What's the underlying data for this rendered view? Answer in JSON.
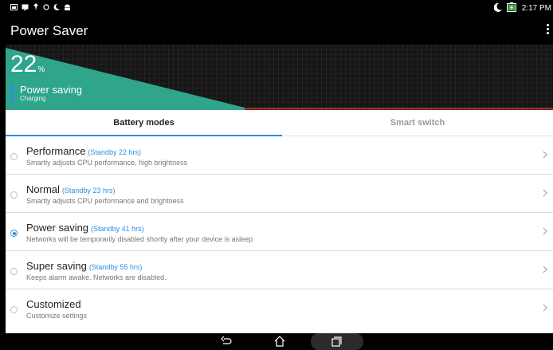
{
  "status_bar": {
    "time": "2:17 PM",
    "left_icons": [
      "gallery-icon",
      "screen-icon",
      "pin-icon",
      "sync-icon",
      "moon-icon",
      "android-icon"
    ],
    "right_icons": [
      "moon-icon",
      "battery-charging-icon"
    ]
  },
  "app_bar": {
    "title": "Power Saver",
    "overflow_icon": "more-vert-icon"
  },
  "battery": {
    "percent": "22",
    "percent_unit": "%",
    "level_fraction": 0.22,
    "mode_label": "Power saving",
    "charging_label": "Charging",
    "graph_color": "#2fa58b"
  },
  "tabs": [
    {
      "label": "Battery modes",
      "active": true
    },
    {
      "label": "Smart switch",
      "active": false
    }
  ],
  "modes": [
    {
      "name": "Performance",
      "standby": "(Standby 22 hrs)",
      "description": "Smartly adjusts CPU performance, high brightness",
      "selected": false
    },
    {
      "name": "Normal",
      "standby": "(Standby 23 hrs)",
      "description": "Smartly adjusts CPU performance and brightness",
      "selected": false
    },
    {
      "name": "Power saving",
      "standby": "(Standby 41 hrs)",
      "description": "Networks will be temporarily disabled shortly after your device is asleep",
      "selected": true
    },
    {
      "name": "Super saving",
      "standby": "(Standby 55 hrs)",
      "description": "Keeps alarm awake. Networks are disabled.",
      "selected": false
    },
    {
      "name": "Customized",
      "standby": "",
      "description": "Customize settings",
      "selected": false
    }
  ],
  "nav_bar": {
    "buttons": [
      "back-icon",
      "home-icon",
      "recents-icon"
    ]
  },
  "colors": {
    "accent": "#2d8fe3",
    "graph_fill": "#2fa58b",
    "graph_line": "#e53935"
  }
}
